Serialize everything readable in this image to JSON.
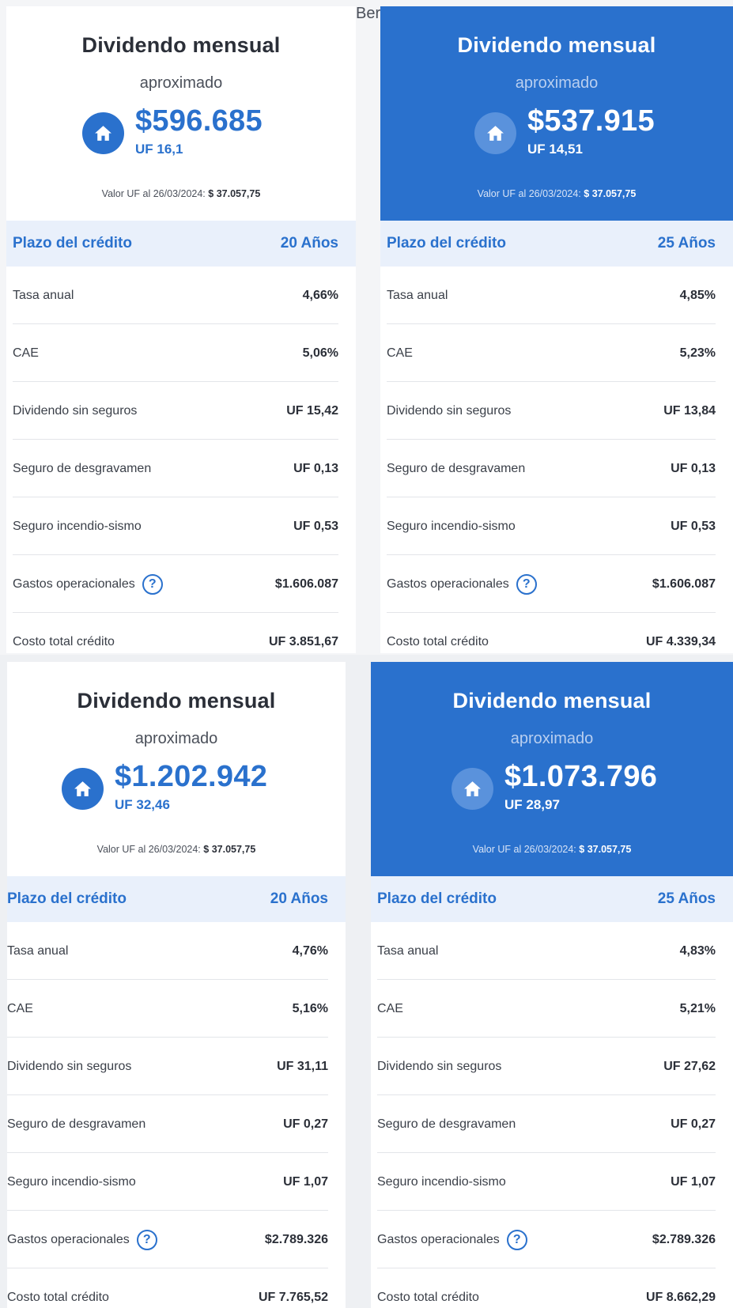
{
  "background_peek_text": "Ber",
  "help_icon_glyph": "?",
  "colors": {
    "accent": "#2a71cd",
    "highlight_bg": "#e9f0fb",
    "text": "#2b2f38"
  },
  "cards": [
    {
      "title": "Dividendo mensual",
      "subtitle": "aproximado",
      "amount": "$596.685",
      "uf": "UF 16,1",
      "valor_label": "Valor UF al 26/03/2024:",
      "valor_value": "$ 37.057,75",
      "plazo_label": "Plazo del crédito",
      "plazo_value": "20 Años",
      "rows": [
        {
          "label": "Tasa anual",
          "value": "4,66%"
        },
        {
          "label": "CAE",
          "value": "5,06%"
        },
        {
          "label": "Dividendo sin seguros",
          "value": "UF 15,42"
        },
        {
          "label": "Seguro de desgravamen",
          "value": "UF 0,13"
        },
        {
          "label": "Seguro incendio-sismo",
          "value": "UF 0,53"
        },
        {
          "label": "Gastos operacionales",
          "value": "$1.606.087"
        },
        {
          "label": "Costo total crédito",
          "value": "UF 3.851,67"
        }
      ]
    },
    {
      "title": "Dividendo mensual",
      "subtitle": "aproximado",
      "amount": "$537.915",
      "uf": "UF 14,51",
      "valor_label": "Valor UF al 26/03/2024:",
      "valor_value": "$ 37.057,75",
      "plazo_label": "Plazo del crédito",
      "plazo_value": "25 Años",
      "rows": [
        {
          "label": "Tasa anual",
          "value": "4,85%"
        },
        {
          "label": "CAE",
          "value": "5,23%"
        },
        {
          "label": "Dividendo sin seguros",
          "value": "UF 13,84"
        },
        {
          "label": "Seguro de desgravamen",
          "value": "UF 0,13"
        },
        {
          "label": "Seguro incendio-sismo",
          "value": "UF 0,53"
        },
        {
          "label": "Gastos operacionales",
          "value": "$1.606.087"
        },
        {
          "label": "Costo total crédito",
          "value": "UF 4.339,34"
        }
      ]
    },
    {
      "title": "Dividendo mensual",
      "subtitle": "aproximado",
      "amount": "$1.202.942",
      "uf": "UF 32,46",
      "valor_label": "Valor UF al 26/03/2024:",
      "valor_value": "$ 37.057,75",
      "plazo_label": "Plazo del crédito",
      "plazo_value": "20 Años",
      "rows": [
        {
          "label": "Tasa anual",
          "value": "4,76%"
        },
        {
          "label": "CAE",
          "value": "5,16%"
        },
        {
          "label": "Dividendo sin seguros",
          "value": "UF 31,11"
        },
        {
          "label": "Seguro de desgravamen",
          "value": "UF 0,27"
        },
        {
          "label": "Seguro incendio-sismo",
          "value": "UF 1,07"
        },
        {
          "label": "Gastos operacionales",
          "value": "$2.789.326"
        },
        {
          "label": "Costo total crédito",
          "value": "UF 7.765,52"
        }
      ]
    },
    {
      "title": "Dividendo mensual",
      "subtitle": "aproximado",
      "amount": "$1.073.796",
      "uf": "UF 28,97",
      "valor_label": "Valor UF al 26/03/2024:",
      "valor_value": "$ 37.057,75",
      "plazo_label": "Plazo del crédito",
      "plazo_value": "25 Años",
      "rows": [
        {
          "label": "Tasa anual",
          "value": "4,83%"
        },
        {
          "label": "CAE",
          "value": "5,21%"
        },
        {
          "label": "Dividendo sin seguros",
          "value": "UF 27,62"
        },
        {
          "label": "Seguro de desgravamen",
          "value": "UF 0,27"
        },
        {
          "label": "Seguro incendio-sismo",
          "value": "UF 1,07"
        },
        {
          "label": "Gastos operacionales",
          "value": "$2.789.326"
        },
        {
          "label": "Costo total crédito",
          "value": "UF 8.662,29"
        }
      ]
    }
  ]
}
